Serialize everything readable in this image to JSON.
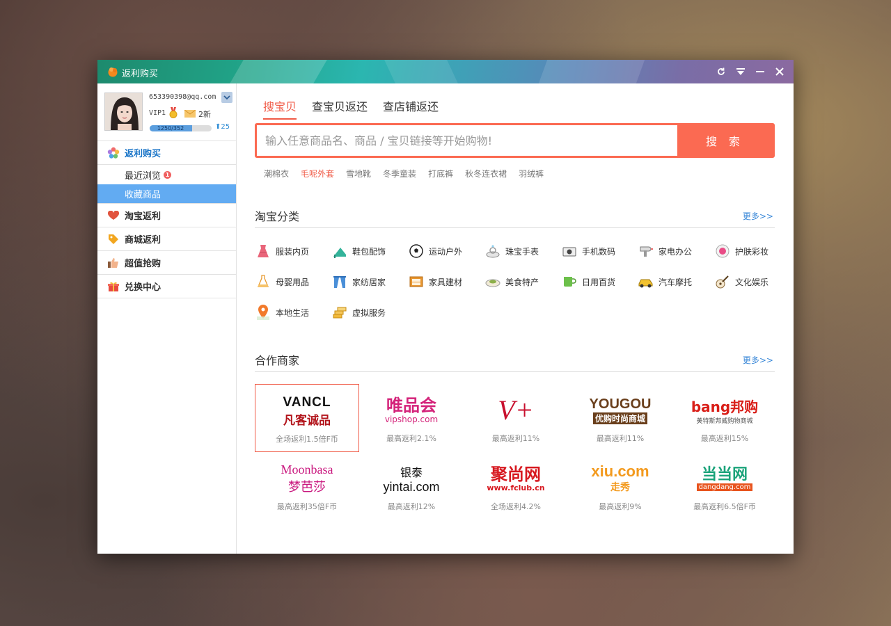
{
  "app": {
    "title": "返利购买"
  },
  "profile": {
    "email": "653390398@qq.com",
    "vip": "VIP1",
    "messages": "2新",
    "exp_text": "1250/352",
    "exp_progress": 0.68,
    "points": "25"
  },
  "sidebar": {
    "group_main": "返利购买",
    "recent": "最近浏览",
    "recent_badge": "1",
    "favorites": "收藏商品",
    "taobao": "淘宝返利",
    "mall": "商城返利",
    "deals": "超值抢购",
    "exchange": "兑换中心"
  },
  "tabs": [
    "搜宝贝",
    "查宝贝返还",
    "查店铺返还"
  ],
  "search": {
    "placeholder": "输入任意商品名、商品 / 宝贝链接等开始购物!",
    "button": "搜 索"
  },
  "hotwords": [
    "潮棉衣",
    "毛呢外套",
    "雪地靴",
    "冬季童装",
    "打底裤",
    "秋冬连衣裙",
    "羽绒裤"
  ],
  "categories_section": {
    "title": "淘宝分类",
    "more": "更多>>"
  },
  "categories": [
    {
      "label": "服装内页",
      "icon": "dress-icon"
    },
    {
      "label": "鞋包配饰",
      "icon": "heel-icon"
    },
    {
      "label": "运动户外",
      "icon": "football-icon"
    },
    {
      "label": "珠宝手表",
      "icon": "ring-icon"
    },
    {
      "label": "手机数码",
      "icon": "camera-icon"
    },
    {
      "label": "家电办公",
      "icon": "hairdryer-icon"
    },
    {
      "label": "护肤彩妆",
      "icon": "compact-icon"
    },
    {
      "label": "母婴用品",
      "icon": "bottle-icon"
    },
    {
      "label": "家纺居家",
      "icon": "curtain-icon"
    },
    {
      "label": "家具建材",
      "icon": "drawer-icon"
    },
    {
      "label": "美食特产",
      "icon": "dish-icon"
    },
    {
      "label": "日用百货",
      "icon": "cup-icon"
    },
    {
      "label": "汽车摩托",
      "icon": "car-icon"
    },
    {
      "label": "文化娱乐",
      "icon": "guitar-icon"
    },
    {
      "label": "本地生活",
      "icon": "map-pin-icon"
    },
    {
      "label": "虚拟服务",
      "icon": "coins-icon"
    }
  ],
  "merchants_section": {
    "title": "合作商家",
    "more": "更多>>"
  },
  "merchants": [
    {
      "name": "vancl",
      "logo_line1": "VANCL",
      "logo_line2": "凡客诚品",
      "rebate": "全场返利1.5倍F币"
    },
    {
      "name": "vipshop",
      "logo_line1": "唯品会",
      "logo_line2": "vipshop.com",
      "rebate": "最高返利2.1%"
    },
    {
      "name": "vplus",
      "logo_line1": "V+",
      "logo_line2": "",
      "rebate": "最高返利11%"
    },
    {
      "name": "yougou",
      "logo_line1": "YOUGOU",
      "logo_line2": "优购时尚商城",
      "rebate": "最高返利11%"
    },
    {
      "name": "banggo",
      "logo_line1": "bang邦购",
      "logo_line2": "美特斯邦威购物商城",
      "rebate": "最高返利15%"
    },
    {
      "name": "moonbasa",
      "logo_line1": "Moonbasa",
      "logo_line2": "梦芭莎",
      "rebate": "最高返利35倍F币"
    },
    {
      "name": "yintai",
      "logo_line1": "银泰",
      "logo_line2": "yintai.com",
      "rebate": "最高返利12%"
    },
    {
      "name": "fclub",
      "logo_line1": "聚尚网",
      "logo_line2": "www.fclub.cn",
      "rebate": "全场返利4.2%"
    },
    {
      "name": "xiu",
      "logo_line1": "xiu.com",
      "logo_line2": "走秀",
      "rebate": "最高返利9%"
    },
    {
      "name": "dangdang",
      "logo_line1": "当当网",
      "logo_line2": "dangdang.com",
      "rebate": "最高返利6.5倍F币"
    }
  ]
}
